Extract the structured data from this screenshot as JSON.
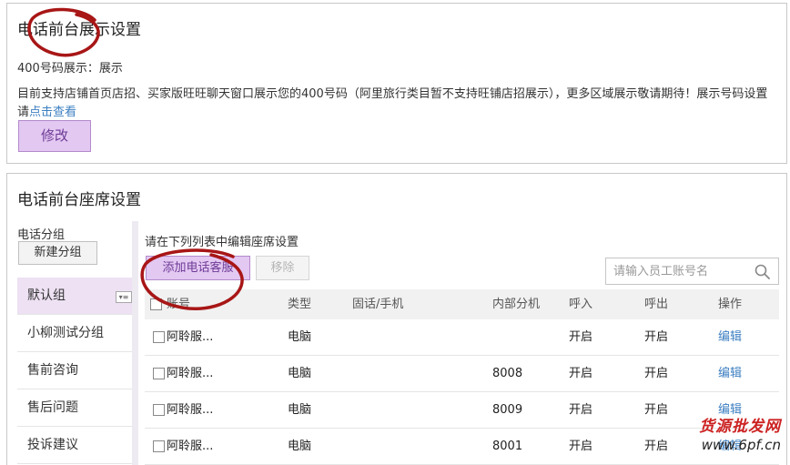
{
  "display": {
    "title": "电话前台展示设置",
    "label_400": "400号码展示：",
    "value_400": "展示",
    "description": "目前支持店铺首页店招、买家版旺旺聊天窗口展示您的400号码（阿里旅行类目暂不支持旺铺店招展示），更多区域展示敬请期待！展示号码设置请",
    "link_text": "点击查看",
    "modify_label": "修改"
  },
  "seats": {
    "title": "电话前台座席设置",
    "group_label": "电话分组",
    "new_group_label": "新建分组",
    "groups": [
      {
        "label": "默认组",
        "active": true
      },
      {
        "label": "小柳测试分组",
        "active": false
      },
      {
        "label": "售前咨询",
        "active": false
      },
      {
        "label": "售后问题",
        "active": false
      },
      {
        "label": "投诉建议",
        "active": false
      }
    ],
    "instruction": "请在下列列表中编辑座席设置",
    "add_label": "添加电话客服",
    "remove_label": "移除",
    "search_placeholder": "请输入员工账号名",
    "columns": [
      "账号",
      "类型",
      "固话/手机",
      "内部分机",
      "呼入",
      "呼出",
      "操作"
    ],
    "rows": [
      {
        "account": "阿聆服...",
        "type": "电脑",
        "phone": "",
        "ext": "",
        "in": "开启",
        "out": "开启",
        "action": "编辑"
      },
      {
        "account": "阿聆服...",
        "type": "电脑",
        "phone": "",
        "ext": "8008",
        "in": "开启",
        "out": "开启",
        "action": "编辑"
      },
      {
        "account": "阿聆服...",
        "type": "电脑",
        "phone": "",
        "ext": "8009",
        "in": "开启",
        "out": "开启",
        "action": "编辑"
      },
      {
        "account": "阿聆服...",
        "type": "电脑",
        "phone": "",
        "ext": "8001",
        "in": "开启",
        "out": "开启",
        "action": "编辑"
      }
    ]
  },
  "watermark": {
    "line1": "货源批发网",
    "line2": "www.6pf.cn"
  },
  "colors": {
    "accent_purple": "#e3c8f2",
    "link_blue": "#3d7fc1",
    "annotation_red": "#a81616"
  }
}
